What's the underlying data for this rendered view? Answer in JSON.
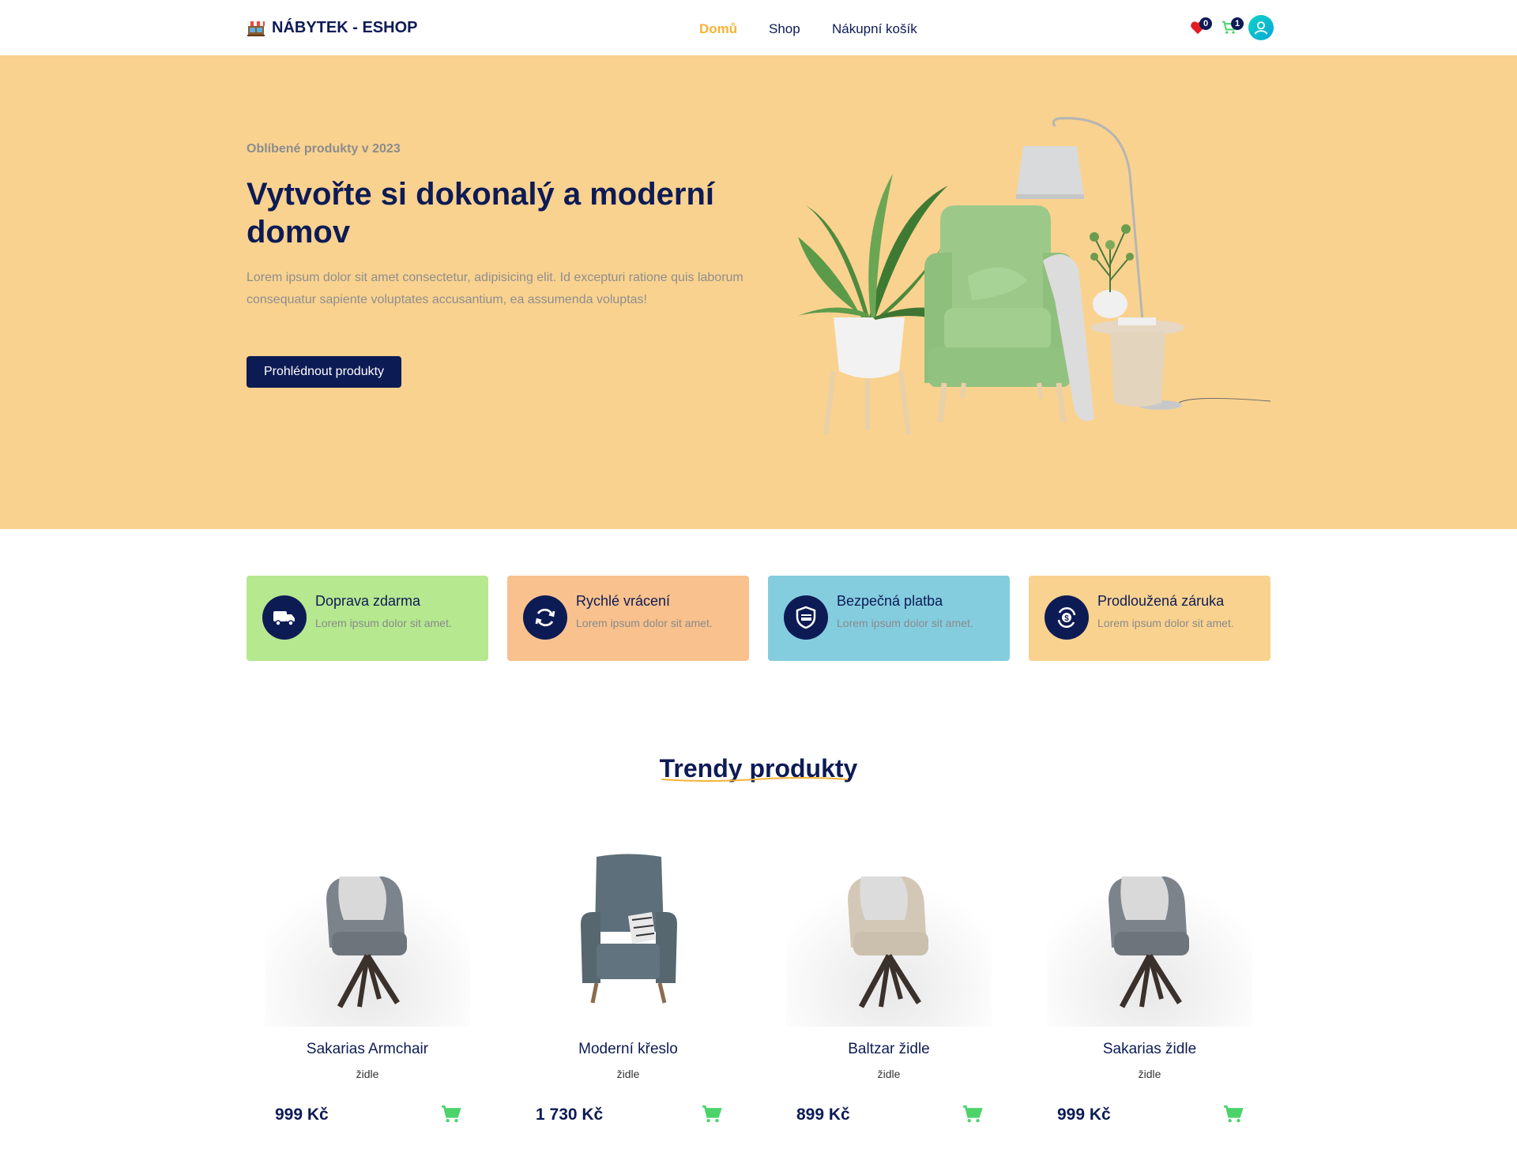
{
  "brand": {
    "name": "NÁBYTEK - ESHOP",
    "icon": "shop-icon"
  },
  "nav": {
    "home": "Domů",
    "shop": "Shop",
    "cart": "Nákupní košík"
  },
  "header_icons": {
    "wishlist_count": "0",
    "cart_count": "1"
  },
  "hero": {
    "subtitle": "Oblíbené produkty v 2023",
    "title": "Vytvořte si dokonalý a moderní domov",
    "description": "Lorem ipsum dolor sit amet consectetur, adipisicing elit. Id excepturi ratione quis laborum consequatur sapiente voluptates accusantium, ea assumenda voluptas!",
    "button": "Prohlédnout produkty"
  },
  "features": [
    {
      "title": "Doprava zdarma",
      "desc": "Lorem ipsum dolor sit amet.",
      "color": "#b6e88f",
      "icon": "truck-icon"
    },
    {
      "title": "Rychlé vrácení",
      "desc": "Lorem ipsum dolor sit amet.",
      "color": "#f8c18d",
      "icon": "refresh-icon"
    },
    {
      "title": "Bezpečná platba",
      "desc": "Lorem ipsum dolor sit amet.",
      "color": "#84cddf",
      "icon": "secure-payment-icon"
    },
    {
      "title": "Prodloužená záruka",
      "desc": "Lorem ipsum dolor sit amet.",
      "color": "#f9d28f",
      "icon": "warranty-icon"
    }
  ],
  "trending": {
    "title": "Trendy produkty",
    "products": [
      {
        "name": "Sakarias Armchair",
        "category": "židle",
        "price": "999 Kč"
      },
      {
        "name": "Moderní křeslo",
        "category": "židle",
        "price": "1 730 Kč"
      },
      {
        "name": "Baltzar židle",
        "category": "židle",
        "price": "899 Kč"
      },
      {
        "name": "Sakarias židle",
        "category": "židle",
        "price": "999 Kč"
      }
    ]
  },
  "colors": {
    "primary": "#0d1b55",
    "accent": "#f5b335",
    "hero_bg": "#f9d28f",
    "cart_green": "#4cd36b"
  }
}
